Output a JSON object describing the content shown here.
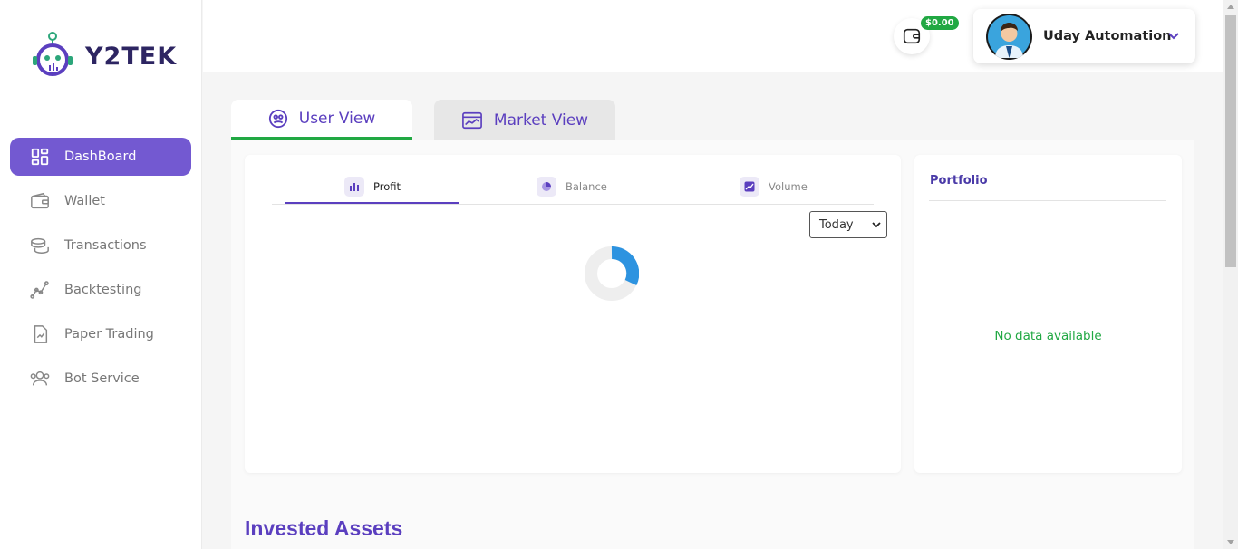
{
  "brand": {
    "logo_text": "Y2TEK"
  },
  "sidebar": {
    "items": [
      {
        "label": "DashBoard",
        "icon": "dashboard-grid-icon",
        "active": true
      },
      {
        "label": "Wallet",
        "icon": "wallet-icon"
      },
      {
        "label": "Transactions",
        "icon": "coins-icon"
      },
      {
        "label": "Backtesting",
        "icon": "line-graph-icon"
      },
      {
        "label": "Paper Trading",
        "icon": "document-chart-icon"
      },
      {
        "label": "Bot Service",
        "icon": "users-group-icon"
      }
    ]
  },
  "header": {
    "wallet_balance": "$0.00",
    "user_name": "Uday Automation"
  },
  "view_tabs": {
    "user_view": "User View",
    "market_view": "Market View"
  },
  "chart_card": {
    "subtabs": [
      "Profit",
      "Balance",
      "Volume"
    ],
    "period": "Today"
  },
  "portfolio": {
    "title": "Portfolio",
    "empty_message": "No data available"
  },
  "sections": {
    "invested_assets": "Invested Assets"
  },
  "colors": {
    "accent": "#7359d1",
    "brand_purple": "#5b3fbf",
    "success_green": "#21a843",
    "spinner_blue": "#2d93e0"
  }
}
